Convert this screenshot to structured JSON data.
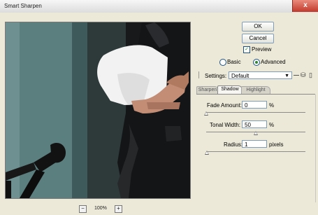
{
  "window": {
    "title": "Smart Sharpen",
    "close_glyph": "x"
  },
  "buttons": {
    "ok": "OK",
    "cancel": "Cancel"
  },
  "preview": {
    "label": "Preview",
    "checked": true
  },
  "mode": {
    "basic": "Basic",
    "advanced": "Advanced",
    "selected": "Advanced"
  },
  "settings": {
    "label": "Settings:",
    "value": "Default"
  },
  "tabs": [
    {
      "label": "Sharpen",
      "active": false
    },
    {
      "label": "Shadow",
      "active": true
    },
    {
      "label": "Highlight",
      "active": false
    }
  ],
  "controls": [
    {
      "label": "Fade Amount:",
      "value": "0",
      "unit": "%",
      "level": 0
    },
    {
      "label": "Tonal Width:",
      "value": "50",
      "unit": "%",
      "level": 0.5
    },
    {
      "label": "Radius:",
      "value": "1",
      "unit": "pixels",
      "level": 0.01
    }
  ],
  "zoom": {
    "minus": "−",
    "plus": "+",
    "level": "100%"
  },
  "icons": {
    "save_settings": "save-icon",
    "delete_settings": "trash-icon"
  },
  "colors": {
    "accent": "#2a8a2a",
    "close": "#c0392b"
  }
}
